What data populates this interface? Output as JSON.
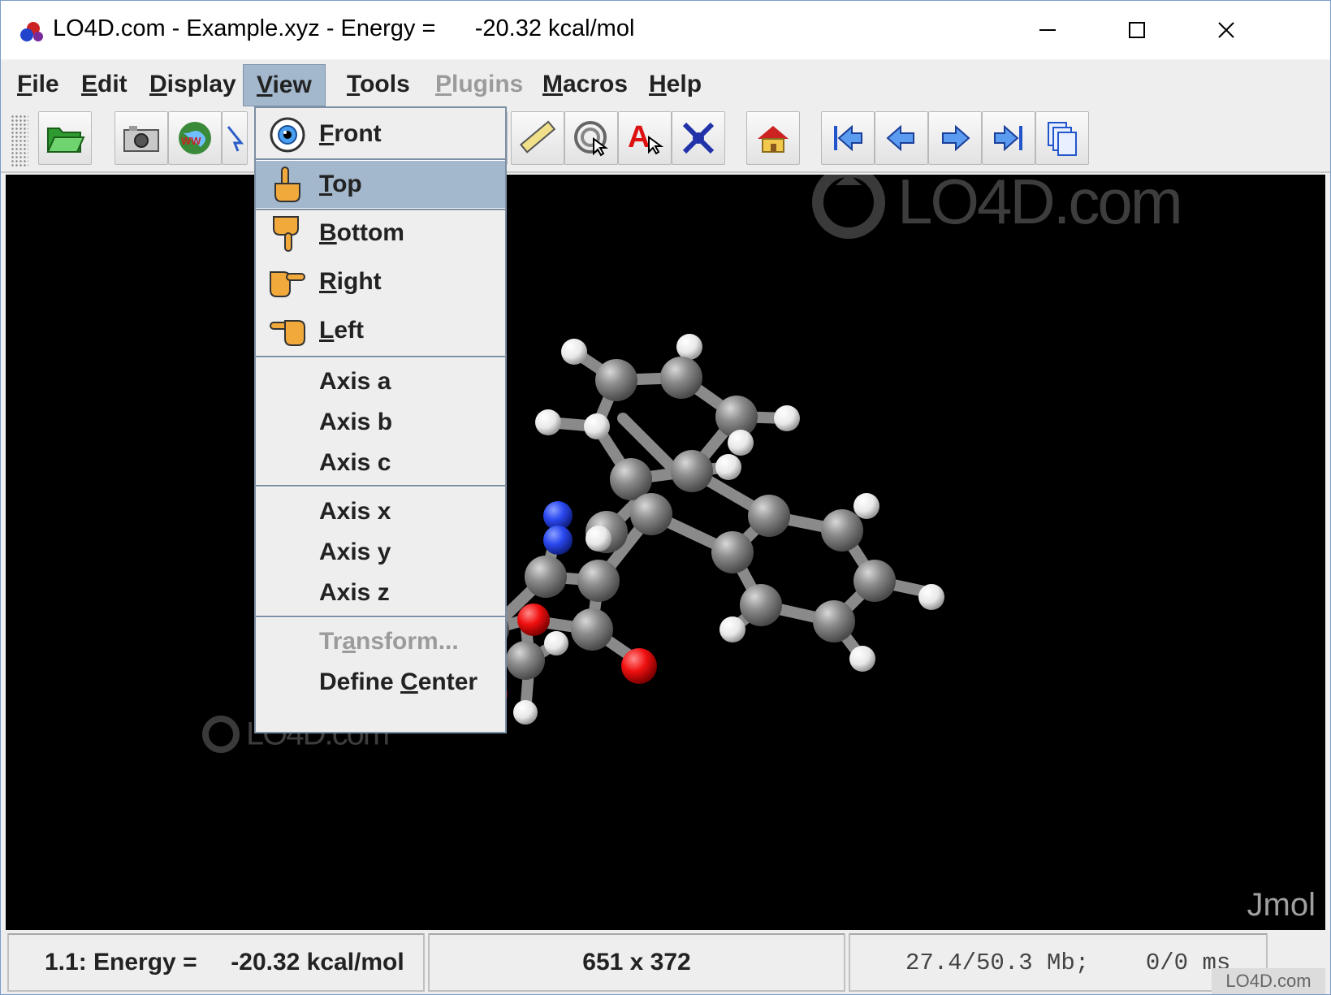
{
  "window": {
    "title": "LO4D.com - Example.xyz - Energy =      -20.32 kcal/mol",
    "controls": {
      "minimize": "minimize-icon",
      "maximize": "maximize-icon",
      "close": "close-icon"
    }
  },
  "menubar": {
    "items": [
      {
        "pre": "",
        "mn": "F",
        "post": "ile",
        "state": "normal"
      },
      {
        "pre": "",
        "mn": "E",
        "post": "dit",
        "state": "normal"
      },
      {
        "pre": "",
        "mn": "D",
        "post": "isplay",
        "state": "normal"
      },
      {
        "pre": "",
        "mn": "V",
        "post": "iew",
        "state": "active"
      },
      {
        "pre": "",
        "mn": "T",
        "post": "ools",
        "state": "normal"
      },
      {
        "pre": "",
        "mn": "P",
        "post": "lugins",
        "state": "disabled"
      },
      {
        "pre": "",
        "mn": "M",
        "post": "acros",
        "state": "normal"
      },
      {
        "pre": "",
        "mn": "H",
        "post": "elp",
        "state": "normal"
      }
    ]
  },
  "toolbar": {
    "buttons": [
      "open-folder-icon",
      "camera-icon",
      "web-export-icon",
      "pick-cursor-icon",
      "measure-ruler-icon",
      "spin-target-icon",
      "label-atom-icon",
      "atom-bond-icon",
      "home-view-icon",
      "first-frame-icon",
      "previous-frame-icon",
      "next-frame-icon",
      "last-frame-icon",
      "all-frames-icon"
    ]
  },
  "view_menu": {
    "items": [
      {
        "pre": "",
        "mn": "F",
        "post": "ront",
        "icon": "eye-icon",
        "highlighted": false,
        "enabled": true
      },
      {
        "pre": "",
        "mn": "T",
        "post": "op",
        "icon": "hand-point-up-icon",
        "highlighted": true,
        "enabled": true
      },
      {
        "pre": "",
        "mn": "B",
        "post": "ottom",
        "icon": "hand-point-down-icon",
        "highlighted": false,
        "enabled": true
      },
      {
        "pre": "",
        "mn": "R",
        "post": "ight",
        "icon": "hand-point-right-icon",
        "highlighted": false,
        "enabled": true
      },
      {
        "pre": "",
        "mn": "L",
        "post": "eft",
        "icon": "hand-point-left-icon",
        "highlighted": false,
        "enabled": true
      },
      {
        "pre": "Axis a",
        "mn": "",
        "post": "",
        "icon": "",
        "highlighted": false,
        "enabled": true
      },
      {
        "pre": "Axis b",
        "mn": "",
        "post": "",
        "icon": "",
        "highlighted": false,
        "enabled": true
      },
      {
        "pre": "Axis c",
        "mn": "",
        "post": "",
        "icon": "",
        "highlighted": false,
        "enabled": true
      },
      {
        "pre": "Axis x",
        "mn": "",
        "post": "",
        "icon": "",
        "highlighted": false,
        "enabled": true
      },
      {
        "pre": "Axis y",
        "mn": "",
        "post": "",
        "icon": "",
        "highlighted": false,
        "enabled": true
      },
      {
        "pre": "Axis z",
        "mn": "",
        "post": "",
        "icon": "",
        "highlighted": false,
        "enabled": true
      },
      {
        "pre": "Tr",
        "mn": "a",
        "post": "nsform...",
        "icon": "",
        "highlighted": false,
        "enabled": false
      },
      {
        "pre": "Define ",
        "mn": "C",
        "post": "enter",
        "icon": "",
        "highlighted": false,
        "enabled": true
      }
    ]
  },
  "viewer": {
    "watermark_large": "LO4D.com",
    "watermark_small": "LO4D.com",
    "renderer_label": "Jmol",
    "atom_colors": {
      "carbon": "#808080",
      "hydrogen": "#f2f2f2",
      "nitrogen": "#1f3ff5",
      "oxygen": "#f20d0d"
    }
  },
  "statusbar": {
    "energy": "1.1: Energy =     -20.32 kcal/mol",
    "dimensions": "651 x 372",
    "memory": "27.4/50.3 Mb;    0/0 ms"
  },
  "corner_watermark": "LO4D.com"
}
